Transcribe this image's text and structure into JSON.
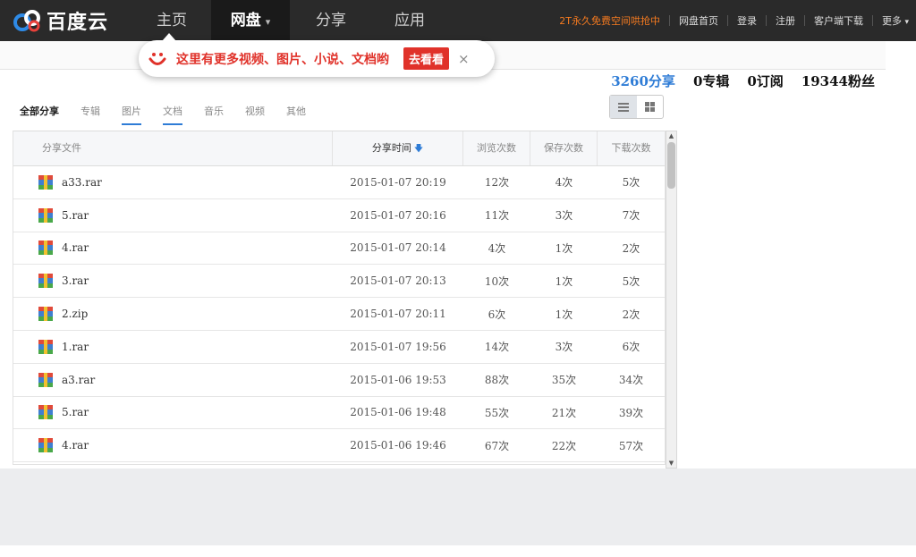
{
  "nav": {
    "logo_text": "百度云",
    "items": [
      {
        "label": "主页"
      },
      {
        "label": "网盘"
      },
      {
        "label": "分享"
      },
      {
        "label": "应用"
      }
    ],
    "right_links": {
      "promo": "2T永久免费空间哄抢中",
      "home": "网盘首页",
      "login": "登录",
      "register": "注册",
      "client_download": "客户端下载",
      "more": "更多"
    }
  },
  "tooltip": {
    "text": "这里有更多视频、图片、小说、文档哟",
    "button": "去看看",
    "close": "×"
  },
  "stats": {
    "shares": "3260分享",
    "albums": "0专辑",
    "subscriptions": "0订阅",
    "fans": "19344粉丝"
  },
  "tabs": [
    "全部分享",
    "专辑",
    "图片",
    "文档",
    "音乐",
    "视频",
    "其他"
  ],
  "table": {
    "headers": {
      "file": "分享文件",
      "time": "分享时间",
      "time_sort_icon": "arrow-down-icon",
      "views": "浏览次数",
      "saves": "保存次数",
      "downloads": "下载次数"
    },
    "rows": [
      {
        "name": "a33.rar",
        "time": "2015-01-07 20:19",
        "views": "12次",
        "saves": "4次",
        "downloads": "5次"
      },
      {
        "name": "5.rar",
        "time": "2015-01-07 20:16",
        "views": "11次",
        "saves": "3次",
        "downloads": "7次"
      },
      {
        "name": "4.rar",
        "time": "2015-01-07 20:14",
        "views": "4次",
        "saves": "1次",
        "downloads": "2次"
      },
      {
        "name": "3.rar",
        "time": "2015-01-07 20:13",
        "views": "10次",
        "saves": "1次",
        "downloads": "5次"
      },
      {
        "name": "2.zip",
        "time": "2015-01-07 20:11",
        "views": "6次",
        "saves": "1次",
        "downloads": "2次"
      },
      {
        "name": "1.rar",
        "time": "2015-01-07 19:56",
        "views": "14次",
        "saves": "3次",
        "downloads": "6次"
      },
      {
        "name": "a3.rar",
        "time": "2015-01-06 19:53",
        "views": "88次",
        "saves": "35次",
        "downloads": "34次"
      },
      {
        "name": "5.rar",
        "time": "2015-01-06 19:48",
        "views": "55次",
        "saves": "21次",
        "downloads": "39次"
      },
      {
        "name": "4.rar",
        "time": "2015-01-06 19:46",
        "views": "67次",
        "saves": "22次",
        "downloads": "57次"
      }
    ]
  },
  "colors": {
    "topbar": "#2a2a2a",
    "accent_blue": "#2e7cd6",
    "promo_orange": "#f47a20",
    "tooltip_red": "#e0322a"
  }
}
